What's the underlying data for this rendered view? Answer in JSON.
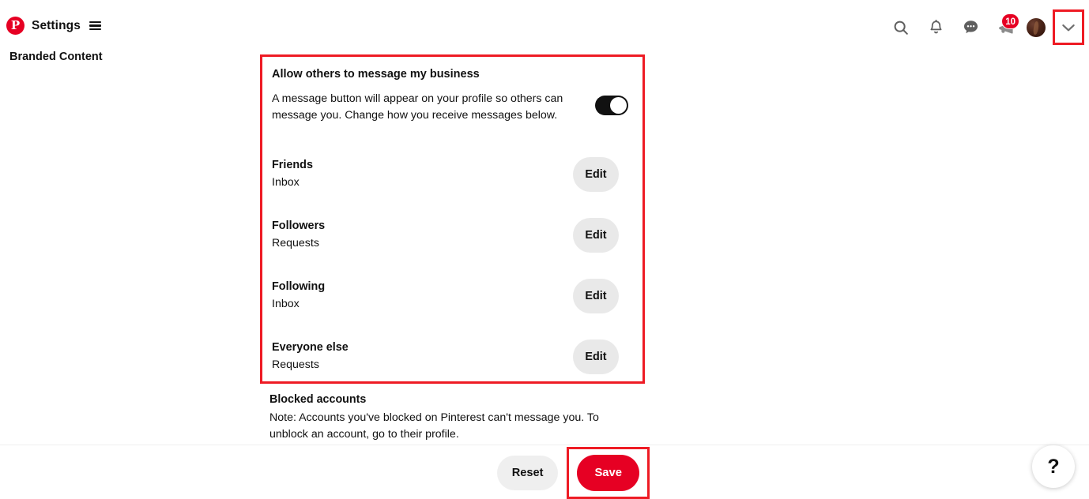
{
  "header": {
    "brand_name": "Pinterest",
    "logo_letter": "P",
    "title": "Settings",
    "menu_icon": "hamburger-icon",
    "actions": [
      {
        "name": "search-icon",
        "label": "Search"
      },
      {
        "name": "bell-icon",
        "label": "Notifications"
      },
      {
        "name": "message-bubble-icon",
        "label": "Messages"
      },
      {
        "name": "megaphone-icon",
        "label": "Announcements",
        "badge": "10"
      },
      {
        "name": "avatar",
        "label": "Account"
      },
      {
        "name": "chevron-down-icon",
        "label": "Account menu"
      }
    ],
    "badge_count": "10"
  },
  "sidebar": {
    "items": [
      {
        "label": "Branded Content"
      }
    ]
  },
  "main": {
    "section": {
      "title": "Allow others to message my business",
      "description": "A message button will appear on your profile so others can message you. Change how you receive messages below.",
      "toggle_state": "on"
    },
    "preferences": [
      {
        "label": "Friends",
        "value": "Inbox",
        "action": "Edit"
      },
      {
        "label": "Followers",
        "value": "Requests",
        "action": "Edit"
      },
      {
        "label": "Following",
        "value": "Inbox",
        "action": "Edit"
      },
      {
        "label": "Everyone else",
        "value": "Requests",
        "action": "Edit"
      }
    ],
    "blocked": {
      "title": "Blocked accounts",
      "note": "Note: Accounts you've blocked on Pinterest can't message you. To unblock an account, go to their profile."
    }
  },
  "footer": {
    "reset_label": "Reset",
    "save_label": "Save",
    "help_label": "?"
  },
  "colors": {
    "brand_red": "#e60023",
    "highlight_red": "#ee1b24",
    "button_gray": "#e9e9e9",
    "text_dark": "#111111"
  }
}
